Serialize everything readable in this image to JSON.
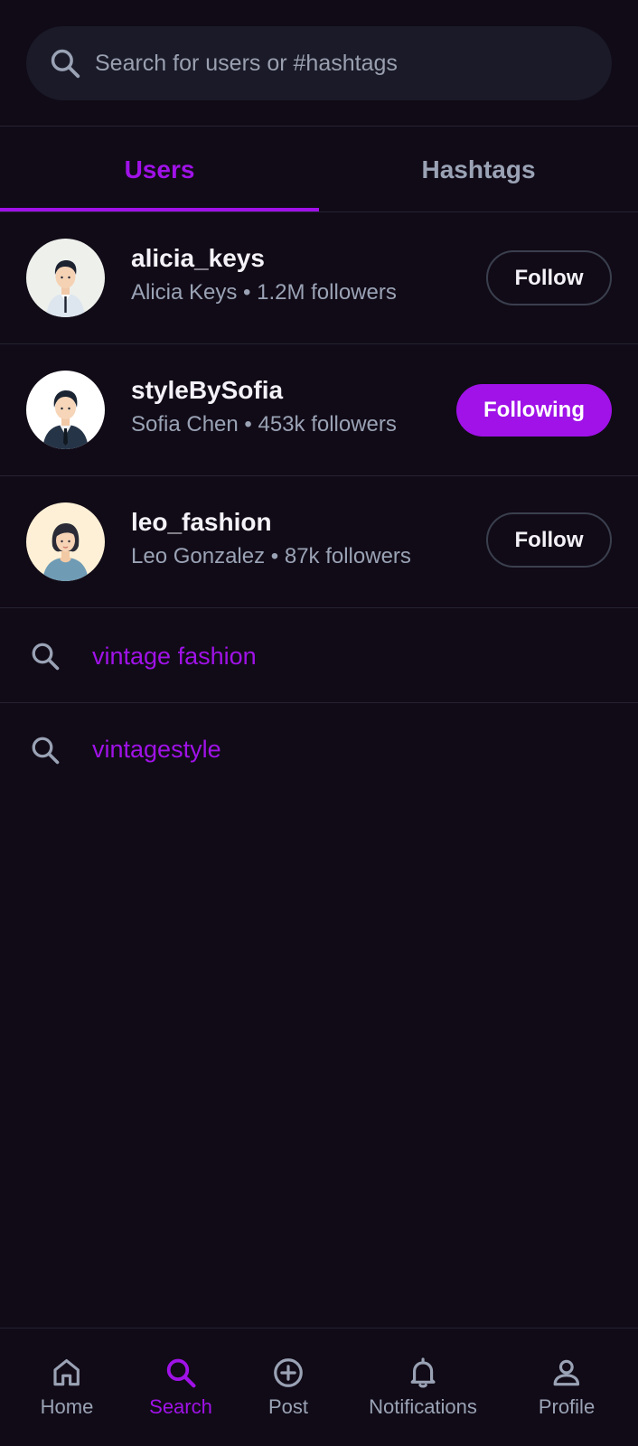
{
  "search": {
    "placeholder": "Search for users or #hashtags",
    "value": ""
  },
  "tabs": [
    {
      "label": "Users",
      "active": true
    },
    {
      "label": "Hashtags",
      "active": false
    }
  ],
  "users": [
    {
      "username": "alicia_keys",
      "meta": "Alicia Keys • 1.2M followers",
      "button": "Follow",
      "following": false
    },
    {
      "username": "styleBySofia",
      "meta": "Sofia Chen • 453k followers",
      "button": "Following",
      "following": true
    },
    {
      "username": "leo_fashion",
      "meta": "Leo Gonzalez • 87k followers",
      "button": "Follow",
      "following": false
    }
  ],
  "recent_searches": [
    {
      "label": "vintage fashion",
      "icon": "search-icon"
    },
    {
      "label": "vintagestyle",
      "icon": "search-icon"
    }
  ],
  "nav": [
    {
      "label": "Home",
      "icon": "home-icon",
      "active": false
    },
    {
      "label": "Search",
      "icon": "search-icon",
      "active": true
    },
    {
      "label": "Post",
      "icon": "plus-circle-icon",
      "active": false
    },
    {
      "label": "Notifications",
      "icon": "bell-icon",
      "active": false
    },
    {
      "label": "Profile",
      "icon": "person-icon",
      "active": false
    }
  ],
  "colors": {
    "accent": "#a012e8",
    "background": "#110b17",
    "muted": "#9aa3b5"
  }
}
